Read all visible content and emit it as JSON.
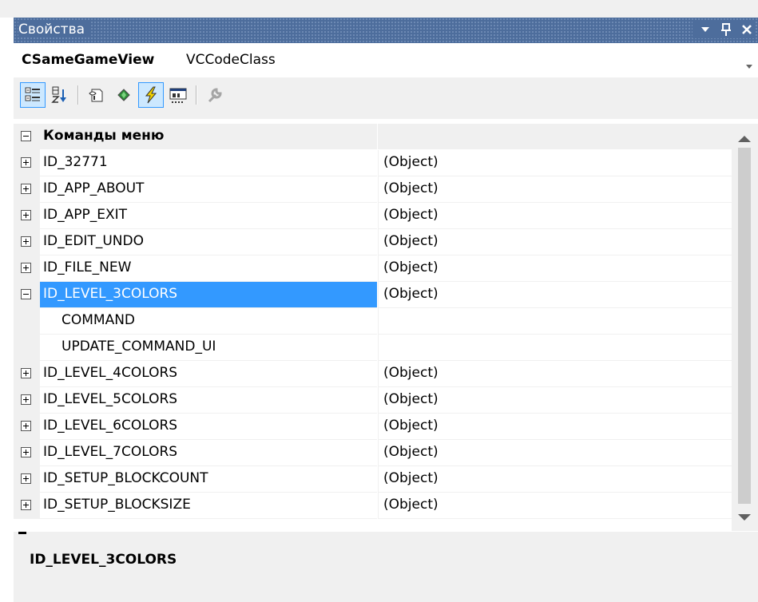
{
  "panel": {
    "title": "Свойства",
    "pin_glyph": "▾",
    "autohide_glyph": "ꟼ",
    "close_glyph": "✕"
  },
  "object": {
    "name": "CSameGameView",
    "type": "VCCodeClass",
    "dropdown_glyph": "▾"
  },
  "toolbar": {
    "tools": [
      {
        "icon": "categorized-icon",
        "active": true
      },
      {
        "icon": "alphabetical-icon",
        "active": false
      },
      {
        "icon": "properties-icon",
        "active": false
      },
      {
        "icon": "events-icon",
        "active": false
      },
      {
        "icon": "messages-icon",
        "active": true
      },
      {
        "icon": "overrides-icon",
        "active": false
      },
      {
        "icon": "property-pages-icon",
        "active": false
      }
    ]
  },
  "grid": {
    "category": "Команды меню",
    "rows": [
      {
        "name": "ID_32771",
        "value": "(Object)"
      },
      {
        "name": "ID_APP_ABOUT",
        "value": "(Object)"
      },
      {
        "name": "ID_APP_EXIT",
        "value": "(Object)"
      },
      {
        "name": "ID_EDIT_UNDO",
        "value": "(Object)"
      },
      {
        "name": "ID_FILE_NEW",
        "value": "(Object)"
      },
      {
        "name": "ID_LEVEL_3COLORS",
        "value": "(Object)"
      },
      {
        "name": "COMMAND",
        "value": ""
      },
      {
        "name": "UPDATE_COMMAND_UI",
        "value": ""
      },
      {
        "name": "ID_LEVEL_4COLORS",
        "value": "(Object)"
      },
      {
        "name": "ID_LEVEL_5COLORS",
        "value": "(Object)"
      },
      {
        "name": "ID_LEVEL_6COLORS",
        "value": "(Object)"
      },
      {
        "name": "ID_LEVEL_7COLORS",
        "value": "(Object)"
      },
      {
        "name": "ID_SETUP_BLOCKCOUNT",
        "value": "(Object)"
      },
      {
        "name": "ID_SETUP_BLOCKSIZE",
        "value": "(Object)"
      }
    ],
    "selected": "ID_LEVEL_3COLORS"
  },
  "description": {
    "title": "ID_LEVEL_3COLORS"
  },
  "colors": {
    "title_bar": "#4d6d9c",
    "selection": "#3399ff",
    "panel_bg": "#f0f0f0"
  }
}
